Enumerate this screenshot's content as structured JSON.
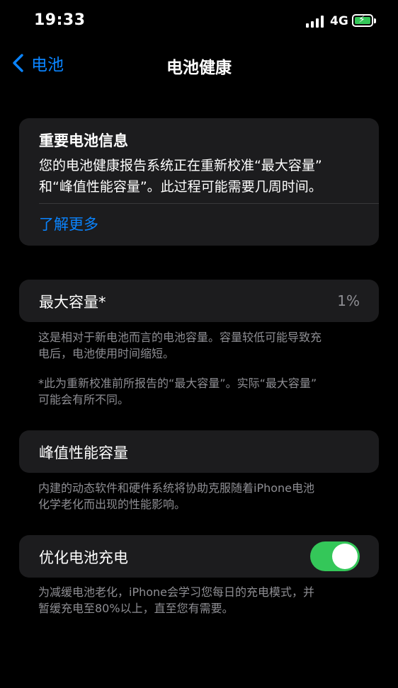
{
  "status_bar": {
    "time": "19:33",
    "network": "4G",
    "battery_state": "charging",
    "battery_color": "#34c759"
  },
  "nav": {
    "back_label": "电池",
    "title": "电池健康",
    "accent_color": "#0a84ff"
  },
  "info_card": {
    "title": "重要电池信息",
    "body_line1": "您的电池健康报告系统正在重新校准“最大容量”",
    "body_line2": "和“峰值性能容量”。此过程可能需要几周时间。",
    "link_label": "了解更多"
  },
  "max_capacity": {
    "label": "最大容量*",
    "value": "1%",
    "desc_line1": "这是相对于新电池而言的电池容量。容量较低可能导致充",
    "desc_line2": "电后，电池使用时间缩短。",
    "note_line1": "*此为重新校准前所报告的“最大容量”。实际“最大容量”",
    "note_line2": "可能会有所不同。"
  },
  "peak_performance": {
    "label": "峰值性能容量",
    "desc_line1": "内建的动态软件和硬件系统将协助克服随着iPhone电池",
    "desc_line2": "化学老化而出现的性能影响。"
  },
  "optimized_charging": {
    "label": "优化电池充电",
    "enabled": true,
    "desc_line1": "为减缓电池老化，iPhone会学习您每日的充电模式，并",
    "desc_line2": "暂缓充电至80%以上，直至您有需要。"
  }
}
